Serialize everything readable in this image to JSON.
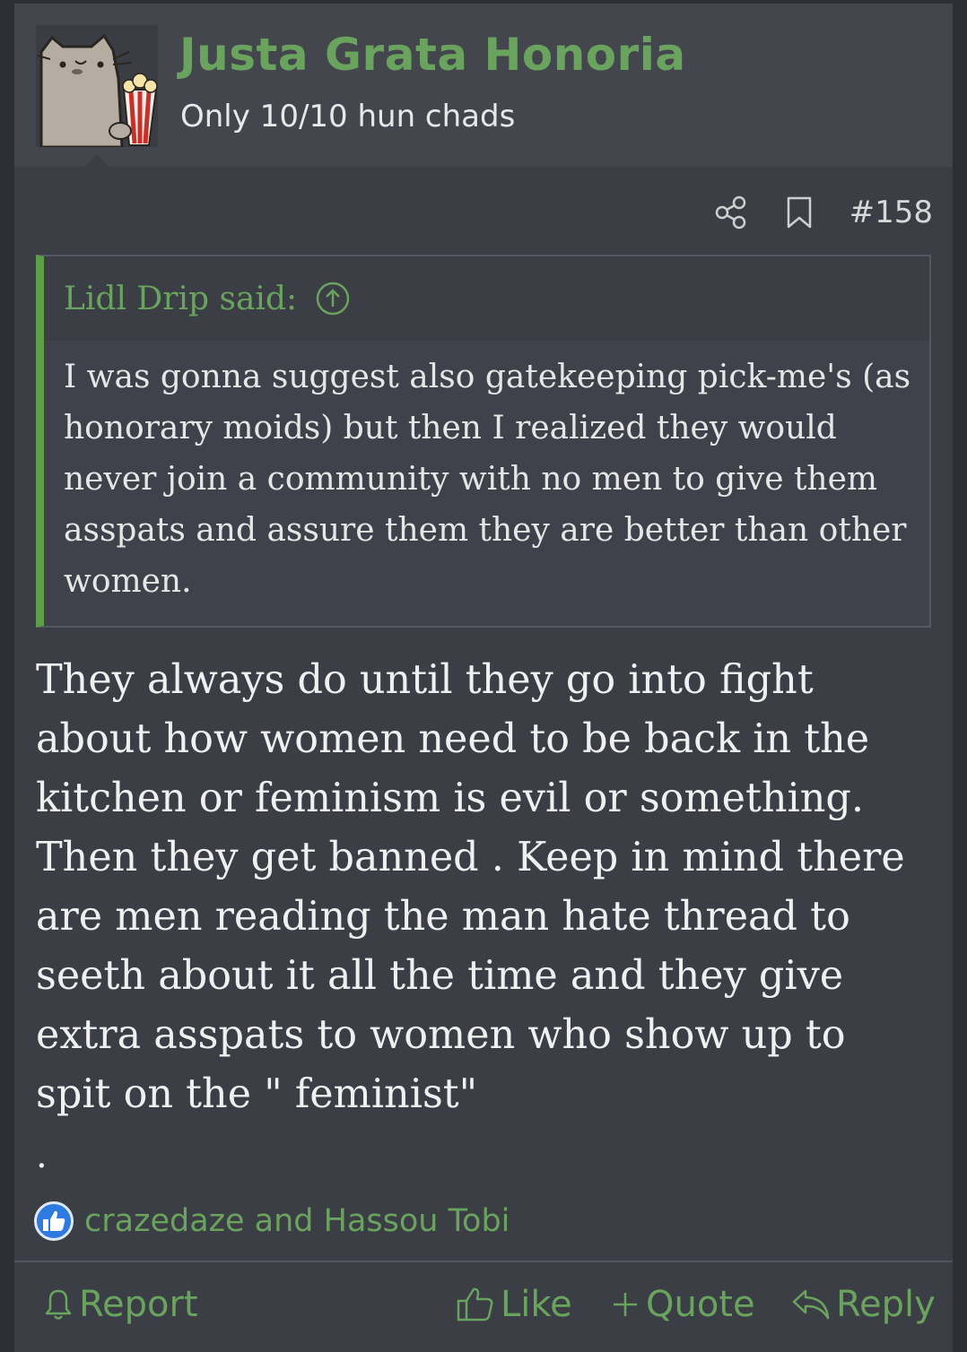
{
  "post": {
    "username": "Justa Grata Honoria",
    "user_title": "Only 10/10 hun chads",
    "post_number": "#158",
    "quote": {
      "author": "Lidl Drip said:",
      "text": "I was gonna suggest also gatekeeping pick-me's (as honorary moids) but then I realized they would never join a community with no men to give them asspats and assure them they are better than other women."
    },
    "message": "They always do until they go into fight about how women need to be back in the kitchen or feminism is evil or something. Then they get banned . Keep in mind there are men reading the man hate thread to seeth about it all the time and they give extra asspats to women who show up to spit on the \" feminist\"",
    "trailing": ".",
    "reactions": {
      "icon": "thumbs-up-icon",
      "users": "crazedaze and Hassou Tobi"
    },
    "actions": {
      "report": "Report",
      "like": "Like",
      "quote": "Quote",
      "reply": "Reply"
    }
  },
  "colors": {
    "page_bg": "#2c2f35",
    "post_bg": "#3b3e45",
    "header_bg": "#43464d",
    "accent_green": "#6aa35e",
    "quote_border": "#5e9e48",
    "like_blue": "#2d7be0"
  }
}
